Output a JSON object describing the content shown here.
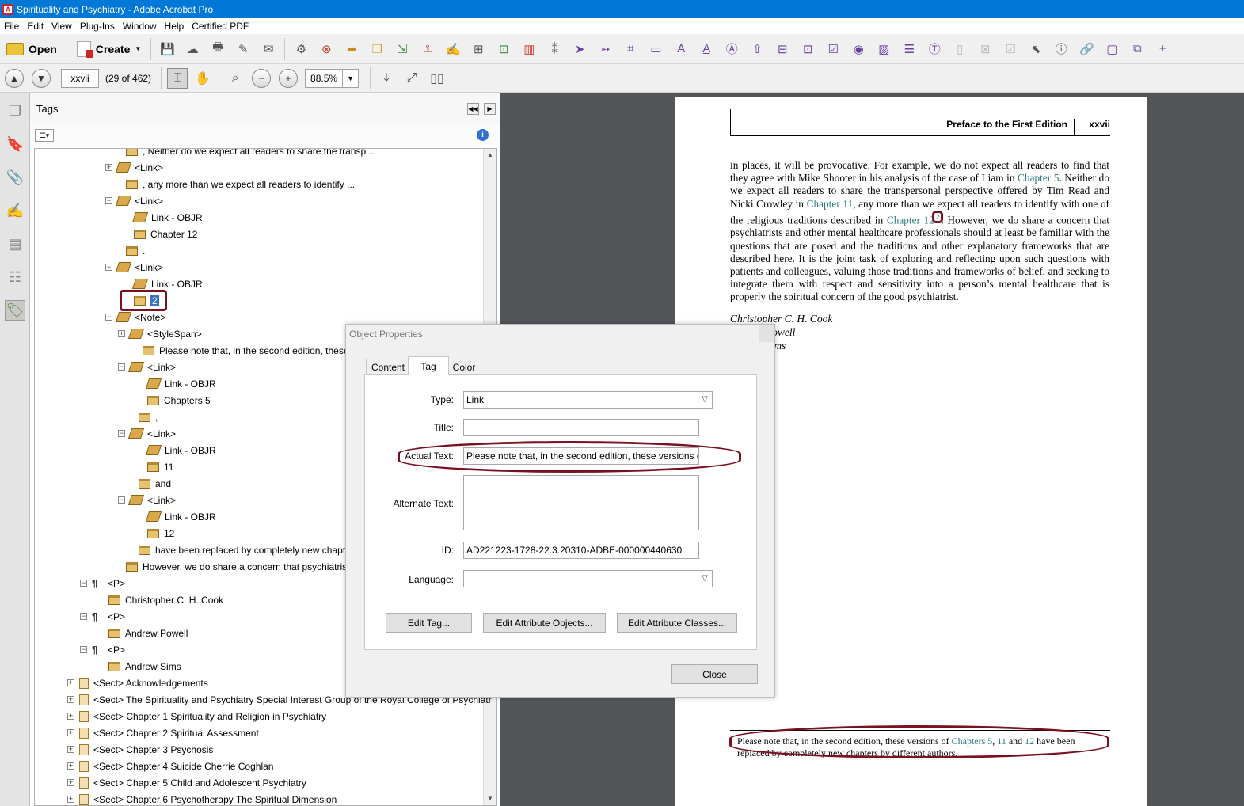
{
  "window": {
    "title": "Spirituality and Psychiatry - Adobe Acrobat Pro"
  },
  "menu": [
    "File",
    "Edit",
    "View",
    "Plug-Ins",
    "Window",
    "Help",
    "Certified PDF"
  ],
  "toolbar": {
    "open_label": "Open",
    "create_label": "Create"
  },
  "nav": {
    "page_value": "xxvii",
    "page_count": "(29 of 462)",
    "zoom": "88.5%"
  },
  "tags_panel": {
    "title": "Tags",
    "rows": [
      {
        "text": ", Neither do we expect all readers to share the transp...",
        "icon": "box",
        "exp": ""
      },
      {
        "text": "<Link>",
        "icon": "tag",
        "exp": "+"
      },
      {
        "text": ", any more than we expect all readers to identify ...",
        "icon": "box",
        "exp": ""
      },
      {
        "text": "<Link>",
        "icon": "tag",
        "exp": "-"
      },
      {
        "text": "Link - OBJR",
        "icon": "tag",
        "exp": ""
      },
      {
        "text": "Chapter 12",
        "icon": "box",
        "exp": ""
      },
      {
        "text": ".",
        "icon": "box",
        "exp": ""
      },
      {
        "text": "<Link>",
        "icon": "tag",
        "exp": "-"
      },
      {
        "text": "Link - OBJR",
        "icon": "tag",
        "exp": ""
      },
      {
        "text": "2",
        "icon": "box",
        "exp": "",
        "selected": true
      },
      {
        "text": "<Note>",
        "icon": "tag",
        "exp": "-"
      },
      {
        "text": "<StyleSpan>",
        "icon": "tag",
        "exp": "+"
      },
      {
        "text": "Please note that, in the second edition, these vers",
        "icon": "box",
        "exp": ""
      },
      {
        "text": "<Link>",
        "icon": "tag",
        "exp": "-"
      },
      {
        "text": "Link - OBJR",
        "icon": "tag",
        "exp": ""
      },
      {
        "text": "Chapters 5",
        "icon": "box",
        "exp": ""
      },
      {
        "text": ",",
        "icon": "box",
        "exp": ""
      },
      {
        "text": "<Link>",
        "icon": "tag",
        "exp": "-"
      },
      {
        "text": "Link - OBJR",
        "icon": "tag",
        "exp": ""
      },
      {
        "text": "11",
        "icon": "box",
        "exp": ""
      },
      {
        "text": "and",
        "icon": "box",
        "exp": ""
      },
      {
        "text": "<Link>",
        "icon": "tag",
        "exp": "-"
      },
      {
        "text": "Link - OBJR",
        "icon": "tag",
        "exp": ""
      },
      {
        "text": "12",
        "icon": "box",
        "exp": ""
      },
      {
        "text": "have been replaced by completely new chapters",
        "icon": "box",
        "exp": ""
      },
      {
        "text": "However, we do share a concern that psychiatrists ...",
        "icon": "box",
        "exp": ""
      },
      {
        "text": "<P>",
        "icon": "para",
        "exp": "-"
      },
      {
        "text": "Christopher C. H. Cook",
        "icon": "box",
        "exp": ""
      },
      {
        "text": "<P>",
        "icon": "para",
        "exp": "-"
      },
      {
        "text": "Andrew Powell",
        "icon": "box",
        "exp": ""
      },
      {
        "text": "<P>",
        "icon": "para",
        "exp": "-"
      },
      {
        "text": "Andrew Sims",
        "icon": "box",
        "exp": ""
      },
      {
        "text": "<Sect> Acknowledgements",
        "icon": "sect",
        "exp": "+"
      },
      {
        "text": "<Sect> The Spirituality and Psychiatry Special Interest Group of the Royal College of Psychiatr",
        "icon": "sect",
        "exp": "+"
      },
      {
        "text": "<Sect> Chapter 1 Spirituality and Religion in Psychiatry",
        "icon": "sect",
        "exp": "+"
      },
      {
        "text": "<Sect> Chapter 2 Spiritual Assessment",
        "icon": "sect",
        "exp": "+"
      },
      {
        "text": "<Sect> Chapter 3 Psychosis",
        "icon": "sect",
        "exp": "+"
      },
      {
        "text": "<Sect> Chapter 4 Suicide Cherrie Coghlan",
        "icon": "sect",
        "exp": "+"
      },
      {
        "text": "<Sect> Chapter 5 Child and Adolescent Psychiatry",
        "icon": "sect",
        "exp": "+"
      },
      {
        "text": "<Sect> Chapter 6 Psychotherapy The Spiritual Dimension",
        "icon": "sect",
        "exp": "+"
      }
    ]
  },
  "dialog": {
    "title": "Object Properties",
    "tabs": [
      "Content",
      "Tag",
      "Color"
    ],
    "type_label": "Type:",
    "type_value": "Link",
    "title_label": "Title:",
    "title_value": "",
    "actual_text_label": "Actual Text:",
    "actual_text_value": "Please note that, in the second edition, these versions of",
    "alt_text_label": "Alternate Text:",
    "alt_text_value": "",
    "id_label": "ID:",
    "id_value": "AD221223-1728-22.3.20310-ADBE-000000440630",
    "language_label": "Language:",
    "language_value": "",
    "edit_tag": "Edit Tag...",
    "edit_attr_objects": "Edit Attribute Objects...",
    "edit_attr_classes": "Edit Attribute Classes...",
    "close": "Close"
  },
  "document": {
    "running_head": "Preface to the First Edition",
    "page_number": "xxvii",
    "p1": "in places, it will be provocative. For example, we do not expect all readers to find that they agree with Mike Shooter in his analysis of the case of Liam in ",
    "link_ch5": "Chapter 5",
    "p2": ". Neither do we expect all readers to share the transpersonal perspective offered by Tim Read and Nicki Crowley in ",
    "link_ch11": "Chapter 11",
    "p3": ", any more than we expect all readers to identify with one of the religious traditions described in ",
    "link_ch12": "Chapter 12",
    "note_ref": "2",
    "p4": ". However, we do share a concern that psychiatrists and other mental healthcare professionals should at least be familiar with the questions that are posed and the traditions and other explanatory frameworks that are described here. It is the joint task of exploring and reflecting upon such questions with patients and colleagues, valuing those traditions and frameworks of belief, and seeking to integrate them with respect and sensitivity into a person’s mental healthcare that is properly the spiritual concern of the good psychiatrist.",
    "sig1": "Christopher C. H. Cook",
    "sig2": "Andrew Powell",
    "sig3": "Andrew Sims",
    "fn_a": "Please note that, in the second edition, these versions of ",
    "fn_l1": "Chapters 5",
    "fn_c": ", ",
    "fn_l2": "11",
    "fn_and": " and ",
    "fn_l3": "12",
    "fn_b": " have been replaced by completely new chapters by different authors."
  },
  "colors": {
    "titlebar": "#0078d7",
    "highlight": "#7b1020",
    "link": "#2a7a7a",
    "viewer_bg": "#525659"
  }
}
